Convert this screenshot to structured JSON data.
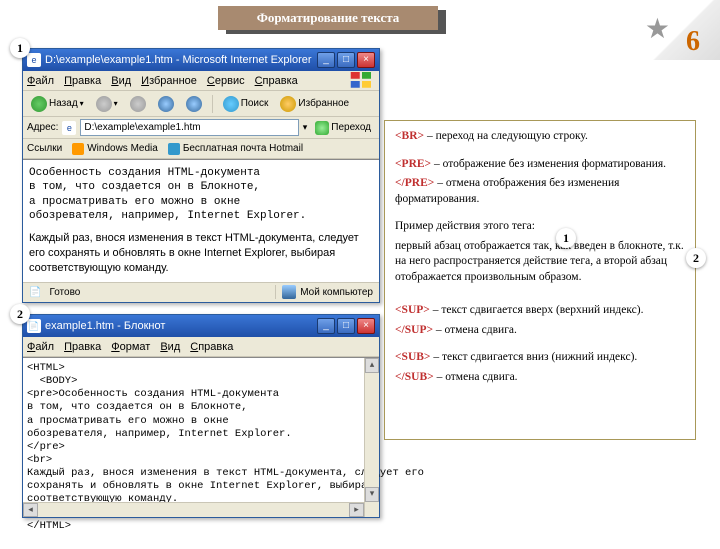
{
  "page": {
    "title": "Форматирование текста",
    "number": "6"
  },
  "badges": {
    "b1": "1",
    "b2": "2",
    "exp1": "1",
    "exp2": "2"
  },
  "ie": {
    "title": "D:\\example\\example1.htm - Microsoft Internet Explorer",
    "menu": {
      "file": "Файл",
      "edit": "Правка",
      "view": "Вид",
      "fav": "Избранное",
      "tools": "Сервис",
      "help": "Справка"
    },
    "toolbar": {
      "back": "Назад",
      "search": "Поиск",
      "fav": "Избранное"
    },
    "addr": {
      "label": "Адрес:",
      "value": "D:\\example\\example1.htm",
      "go": "Переход"
    },
    "links": {
      "label": "Ссылки",
      "wm": "Windows Media",
      "hotmail": "Бесплатная почта Hotmail"
    },
    "content_pre": "Особенность создания HTML-документа\nв том, что создается он в Блокноте,\nа просматривать его можно в окне\nобозревателя, например, Internet Explorer.",
    "content_p": "Каждый раз, внося изменения в текст HTML-документа, следует его сохранять и обновлять в окне Internet Explorer, выбирая соответствующую команду.",
    "status": {
      "ready": "Готово",
      "mycomp": "Мой компьютер"
    }
  },
  "notepad": {
    "title": "example1.htm - Блокнот",
    "menu": {
      "file": "Файл",
      "edit": "Правка",
      "format": "Формат",
      "view": "Вид",
      "help": "Справка"
    },
    "body": "<HTML>\n  <BODY>\n<pre>Особенность создания HTML-документа\nв том, что создается он в Блокноте,\nа просматривать его можно в окне\nобозревателя, например, Internet Explorer.\n</pre>\n<br>\nКаждый раз, внося изменения в текст HTML-документа, следует его\nсохранять и обновлять в окне Internet Explorer, выбирая\nсоответствующую команду.\n  </BODY>\n</HTML>"
  },
  "explain": {
    "br_tag": "<BR>",
    "br_desc": " – переход на следующую строку.",
    "pre_tag": "<PRE>",
    "pre_desc": " – отображение без изменения форматирования.",
    "preend_tag": "</PRE>",
    "preend_desc": " – отмена отображения без изменения форматирования.",
    "sample_intro": "Пример действия этого тега:",
    "sample_body": "первый абзац отображается так, как введен в блокноте, т.к. на него распространяется действие тега, а второй абзац отображается произвольным образом.",
    "sup_tag": "<SUP>",
    "sup_desc": " – текст сдвигается вверх (верхний индекс).",
    "supend_tag": "</SUP>",
    "supend_desc": " – отмена сдвига.",
    "sub_tag": "<SUB>",
    "sub_desc": " – текст сдвигается вниз (нижний индекс).",
    "subend_tag": "</SUB>",
    "subend_desc": " – отмена сдвига."
  }
}
